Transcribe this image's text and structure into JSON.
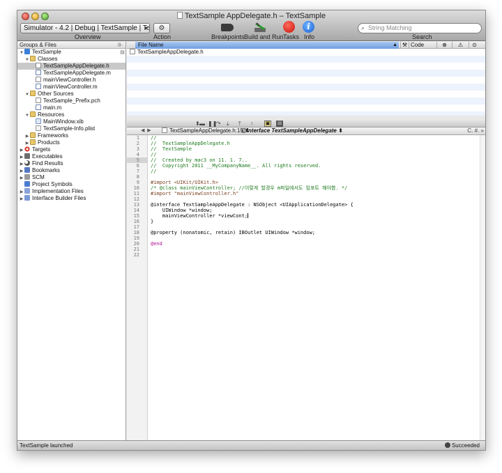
{
  "window": {
    "title": "TextSample AppDelegate.h – TextSample"
  },
  "toolbar": {
    "scheme": "Simulator - 4.2 | Debug | TextSample | Te...",
    "overview_label": "Overview",
    "action_label": "Action",
    "action_glyph": "⚙",
    "breakpoints_label": "Breakpoints",
    "build_and_run_label": "Build and Run",
    "tasks_label": "Tasks",
    "info_label": "Info",
    "info_glyph": "i",
    "search_placeholder": "String Matching",
    "search_label": "Search"
  },
  "sidebar": {
    "header": "Groups & Files",
    "items": [
      {
        "label": "TextSample",
        "icon": "project-icon"
      },
      {
        "label": "Classes",
        "icon": "folder-icon"
      },
      {
        "label": "TextSampleAppDelegate.h",
        "icon": "header-file-icon"
      },
      {
        "label": "TextSampleAppDelegate.m",
        "icon": "source-file-icon"
      },
      {
        "label": "mainViewController.h",
        "icon": "header-file-icon"
      },
      {
        "label": "mainViewController.m",
        "icon": "source-file-icon"
      },
      {
        "label": "Other Sources",
        "icon": "folder-icon"
      },
      {
        "label": "TextSample_Prefix.pch",
        "icon": "header-file-icon"
      },
      {
        "label": "main.m",
        "icon": "source-file-icon"
      },
      {
        "label": "Resources",
        "icon": "folder-icon"
      },
      {
        "label": "MainWindow.xib",
        "icon": "xib-file-icon"
      },
      {
        "label": "TextSample-Info.plist",
        "icon": "plist-file-icon"
      },
      {
        "label": "Frameworks",
        "icon": "folder-icon"
      },
      {
        "label": "Products",
        "icon": "folder-icon"
      },
      {
        "label": "Targets",
        "icon": "target-icon"
      },
      {
        "label": "Executables",
        "icon": "executable-icon"
      },
      {
        "label": "Find Results",
        "icon": "find-icon"
      },
      {
        "label": "Bookmarks",
        "icon": "bookmark-icon"
      },
      {
        "label": "SCM",
        "icon": "scm-icon"
      },
      {
        "label": "Project Symbols",
        "icon": "symbols-icon"
      },
      {
        "label": "Implementation Files",
        "icon": "implementation-icon"
      },
      {
        "label": "Interface Builder Files",
        "icon": "interface-builder-icon"
      }
    ]
  },
  "detail": {
    "columns": {
      "file_name": "File Name",
      "code": "Code"
    },
    "rows": [
      {
        "file_name": "TextSampleAppDelegate.h"
      }
    ]
  },
  "navigator": {
    "file": "TextSampleAppDelegate.h:15",
    "symbol": "@interface TextSampleAppDelegate",
    "right_controls": "C. #. »"
  },
  "editor": {
    "line_numbers": [
      "1",
      "2",
      "3",
      "4",
      "5",
      "6",
      "7",
      "8",
      "9",
      "10",
      "11",
      "12",
      "13",
      "14",
      "15",
      "16",
      "17",
      "18",
      "19",
      "20",
      "21",
      "22"
    ],
    "lines": [
      "//",
      "//  TextSampleAppDelegate.h",
      "//  TextSample",
      "//",
      "//  Created by mac3 on 11. 1. 7..",
      "//  Copyright 2011 __MyCompanyName__. All rights reserved.",
      "//",
      "",
      "#import <UIKit/UIKit.h>",
      "/* @class mainViewController; //이렇게 할경우 m파일에서도 임포트 해야함. */",
      "#import \"mainViewController.h\"",
      "",
      "@interface TextSampleAppDelegate : NSObject <UIApplicationDelegate> {",
      "    UIWindow *window;",
      "    mainViewController *viewCont;",
      "}",
      "",
      "@property (nonatomic, retain) IBOutlet UIWindow *window;",
      "",
      "@end",
      "",
      ""
    ]
  },
  "status": {
    "left": "TextSample launched",
    "right": "Succeeded"
  }
}
